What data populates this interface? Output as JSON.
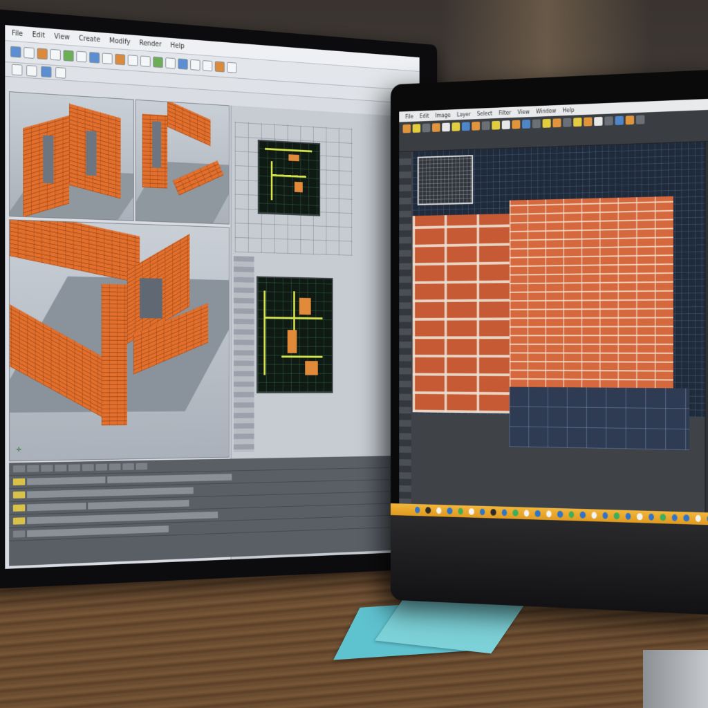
{
  "scene": {
    "left_monitor": {
      "menu_items": [
        "File",
        "Edit",
        "View",
        "Create",
        "Modify",
        "Render",
        "Help"
      ],
      "toolbar_rows": 2,
      "viewports": [
        "perspective-top-left",
        "perspective-top-right",
        "perspective-main"
      ],
      "schematic_panels": 2,
      "timeline_rows": 6
    },
    "right_monitor": {
      "menu_items": [
        "File",
        "Edit",
        "Image",
        "Layer",
        "Select",
        "Filter",
        "View",
        "Window",
        "Help"
      ],
      "dock_icon_count": 28
    },
    "colors": {
      "brick_orange": "#e26f2c",
      "schematic_green": "#d7e34a",
      "dock_orange": "#f2b63b",
      "sticky_note": "#5fc2cf"
    },
    "icons": [
      "axis-gizmo-icon",
      "toolbar-icons",
      "dock-app-icons"
    ]
  }
}
